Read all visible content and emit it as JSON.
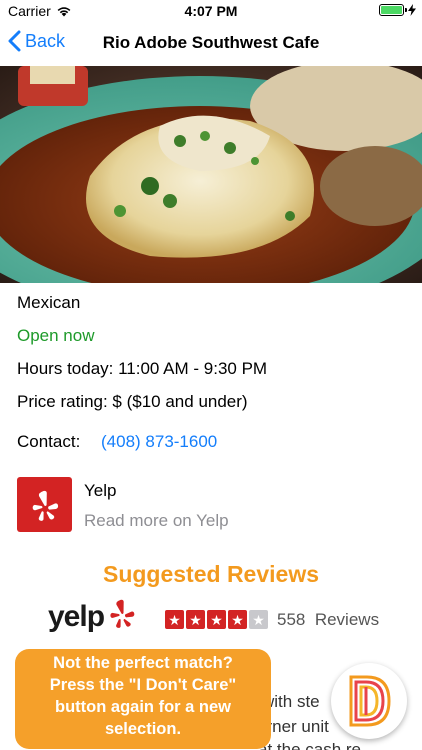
{
  "status_bar": {
    "carrier": "Carrier",
    "time": "4:07 PM"
  },
  "nav": {
    "back_label": "Back",
    "title": "Rio Adobe Southwest Cafe"
  },
  "details": {
    "cuisine": "Mexican",
    "open_status": "Open now",
    "hours": "Hours today:  11:00 AM - 9:30 PM",
    "price": "Price rating:  $  ($10 and under)",
    "contact_label": "Contact:",
    "phone": "(408) 873-1600"
  },
  "yelp_link": {
    "title": "Yelp",
    "subtitle": "Read more on Yelp"
  },
  "reviews": {
    "heading": "Suggested Reviews",
    "brand": "yelp",
    "rating": 4,
    "max_rating": 5,
    "count": "558",
    "count_label": "Reviews",
    "snippet_lines": [
      "with ste",
      "orner unit",
      "at the cash re"
    ]
  },
  "banner": {
    "lines": [
      "Not the perfect match?",
      "Press the \"I Don't Care\"",
      "button again for a new",
      "selection."
    ]
  },
  "colors": {
    "accent_blue": "#147efb",
    "open_green": "#1e9a2a",
    "yelp_red": "#d32323",
    "heading_orange": "#f39a1e",
    "banner_orange": "#f5a02a"
  }
}
